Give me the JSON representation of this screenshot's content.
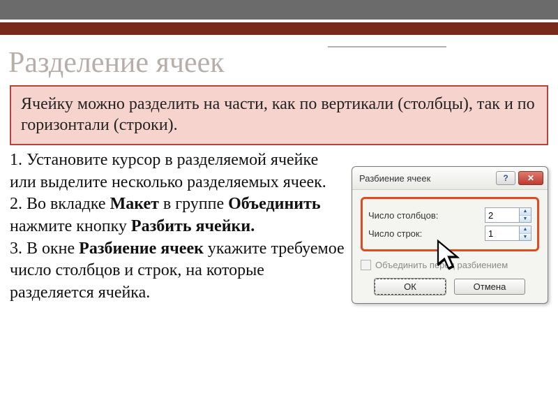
{
  "header": {
    "page_title": "Разделение ячеек",
    "callout_text": "Ячейку можно разделить на части, как по вертикали (столбцы), так и по горизонтали (строки)."
  },
  "steps": {
    "s1_a": "1. Установите курсор в разделяемой ячейке или выделите несколько разделяемых ячеек.",
    "s2_a": "2. Во вкладке ",
    "s2_b": "Макет",
    "s2_c": " в группе ",
    "s2_d": "Объединить",
    "s2_e": " нажмите кнопку ",
    "s2_f": "Разбить ячейки.",
    "s3_a": "3. В окне ",
    "s3_b": "Разбиение ячеек",
    "s3_c": "  укажите требуемое число столбцов и строк, на которые разделяется ячейка."
  },
  "dialog": {
    "title": "Разбиение ячеек",
    "help_glyph": "?",
    "close_glyph": "✕",
    "cols_label": "Число столбцов:",
    "rows_label": "Число строк:",
    "cols_value": "2",
    "rows_value": "1",
    "merge_label": "Объединить перед разбиением",
    "ok_label": "ОК",
    "cancel_label": "Отмена",
    "spin_up": "▲",
    "spin_down": "▼"
  }
}
